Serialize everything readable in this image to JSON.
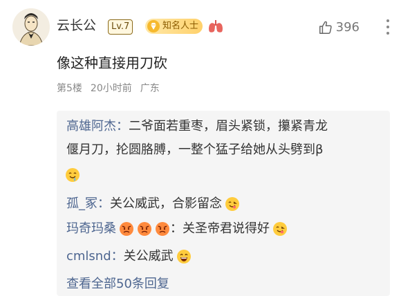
{
  "user": {
    "name": "云长公",
    "level": "Lv.7",
    "fame_badge": "知名人士"
  },
  "like_count": "396",
  "comment": {
    "text": "像这种直接用刀砍",
    "floor": "第5楼",
    "time": "20小时前",
    "location": "广东"
  },
  "replies": [
    {
      "name": "高雄阿杰：",
      "text_line1": "二爷面若重枣，眉头紧锁，攥紧青龙",
      "text_line2": "偃月刀，抡圆胳膊，一整个猛子给她从头劈到β",
      "emoji": "drool-emoji"
    },
    {
      "name": "孤_冢：",
      "text": "关公威武，合影留念",
      "emoji": "yum-emoji"
    },
    {
      "name": "玛奇玛桑",
      "text": "：关圣帝君说得好",
      "name_emojis": [
        "angry-emoji",
        "angry-emoji",
        "angry-emoji"
      ],
      "emoji": "yum-emoji"
    },
    {
      "name": "cmlsnd：",
      "text": "关公威武",
      "emoji": "grin-emoji"
    }
  ],
  "view_all": "查看全部50条回复",
  "colors": {
    "reply_name": "#4e6690",
    "reply_bg": "#f5f5f5",
    "meta": "#888888"
  }
}
